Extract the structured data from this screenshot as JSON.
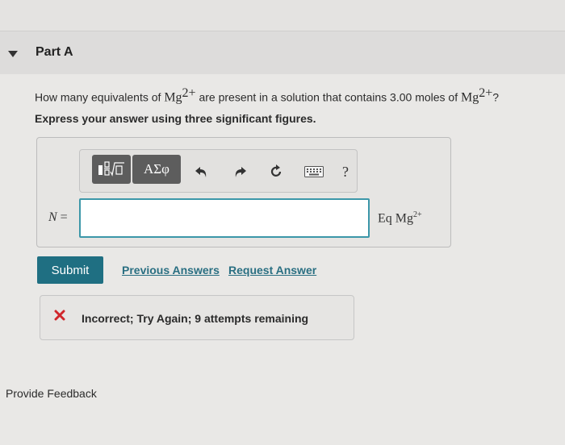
{
  "part": {
    "title": "Part A"
  },
  "question": {
    "text_before": "How many equivalents of ",
    "ion_symbol": "Mg",
    "ion_charge": "2+",
    "text_middle": " are present in a solution that contains 3.00 moles of ",
    "text_end": "?",
    "instruction": "Express your answer using three significant figures."
  },
  "toolbar": {
    "templates_icon": "fraction-sqrt-template-icon",
    "greek_label": "ΑΣφ",
    "undo_icon": "undo-arrow-icon",
    "redo_icon": "redo-arrow-icon",
    "reset_icon": "reset-icon",
    "keyboard_icon": "keyboard-icon",
    "help_label": "?"
  },
  "answer": {
    "variable_label": "N",
    "equals": " =",
    "value": "",
    "unit_text": "Eq Mg",
    "unit_charge": "2+"
  },
  "actions": {
    "submit_label": "Submit",
    "previous_answers_label": "Previous Answers",
    "request_answer_label": "Request Answer"
  },
  "feedback": {
    "icon": "x-mark-icon",
    "message": "Incorrect; Try Again; 9 attempts remaining"
  },
  "footer": {
    "provide_feedback_label": "Provide Feedback"
  },
  "colors": {
    "accent": "#1f6f82",
    "link": "#2a6f82",
    "input_border": "#3c97a9",
    "error": "#d0262b",
    "toolbar_button": "#5d5d5d"
  }
}
